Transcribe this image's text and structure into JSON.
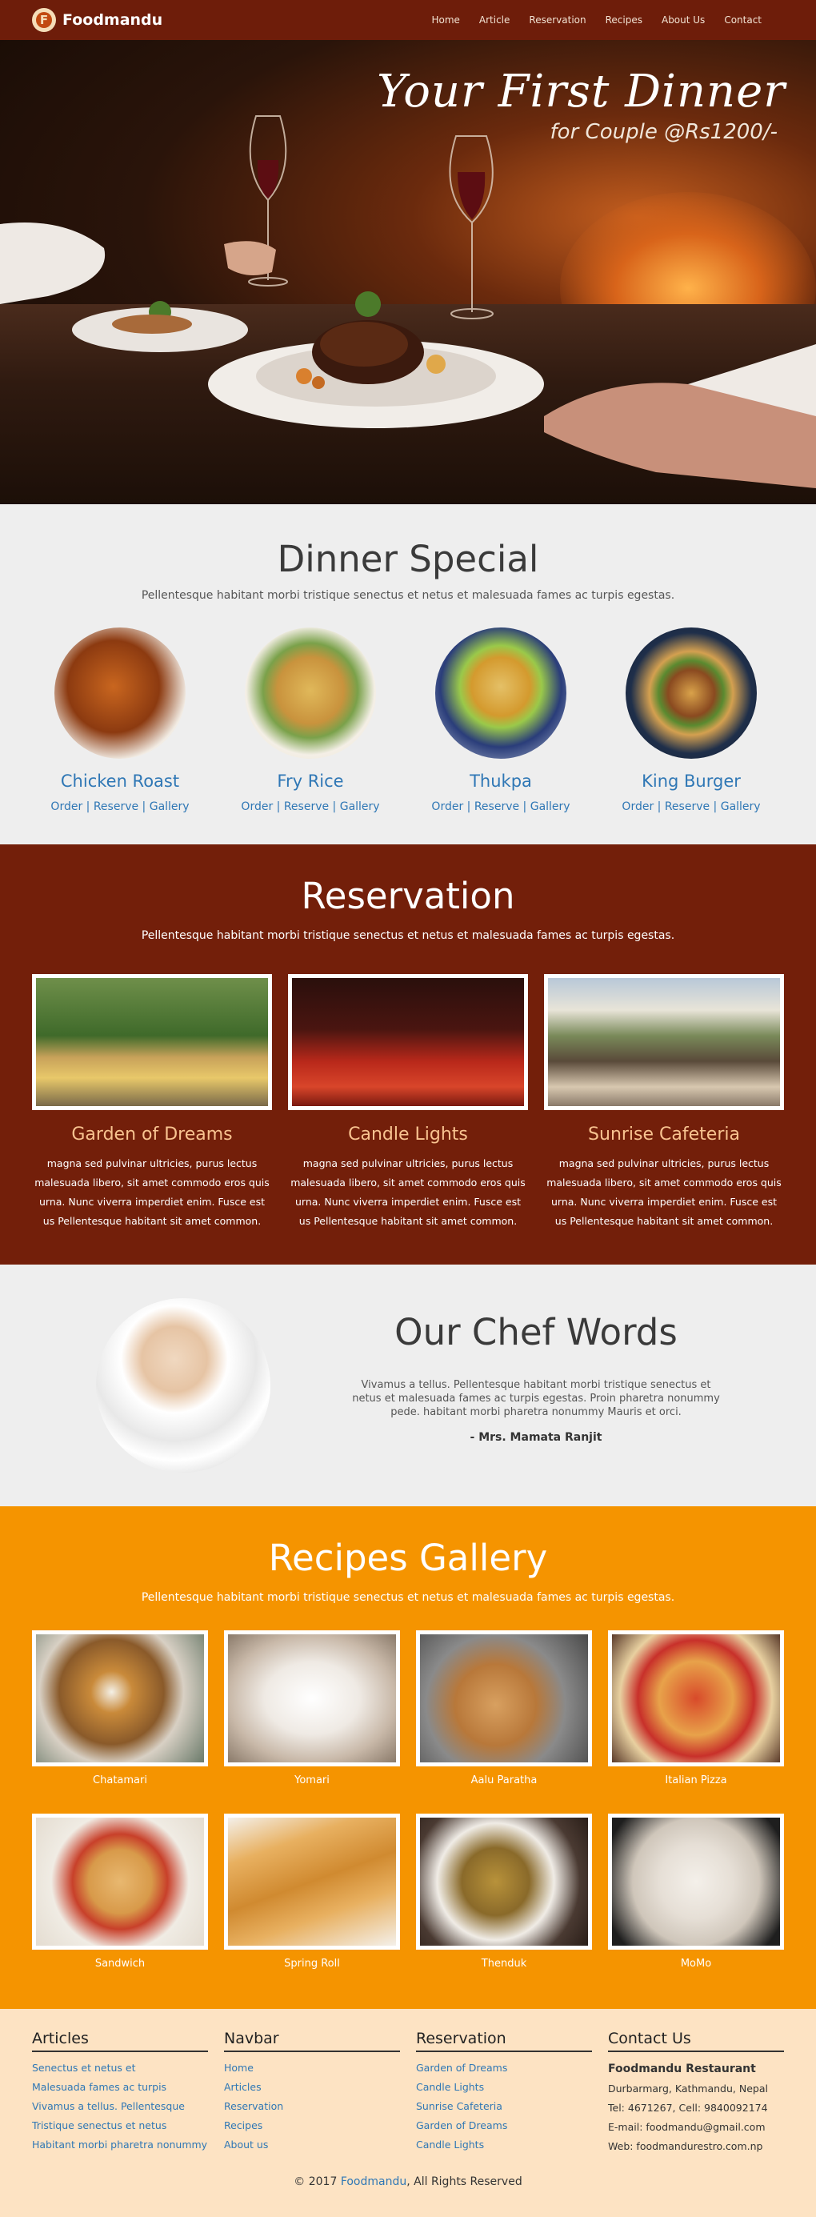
{
  "nav": {
    "brand": "Foodmandu",
    "links": [
      "Home",
      "Article",
      "Reservation",
      "Recipes",
      "About Us",
      "Contact"
    ]
  },
  "hero": {
    "title": "Your First Dinner",
    "subtitle": "for Couple @Rs1200/-"
  },
  "dinner": {
    "title": "Dinner Special",
    "description": "Pellentesque habitant morbi tristique senectus et netus et malesuada fames ac turpis egestas.",
    "dishes": [
      {
        "name": "Chicken Roast",
        "links": "Order | Reserve | Gallery"
      },
      {
        "name": "Fry Rice",
        "links": "Order | Reserve | Gallery"
      },
      {
        "name": "Thukpa",
        "links": "Order | Reserve | Gallery"
      },
      {
        "name": "King Burger",
        "links": "Order | Reserve | Gallery"
      }
    ]
  },
  "reservation": {
    "title": "Reservation",
    "description": "Pellentesque habitant morbi tristique senectus et netus et malesuada fames ac turpis egestas.",
    "venues": [
      {
        "name": "Garden of Dreams",
        "text": "magna sed pulvinar ultricies, purus lectus malesuada libero, sit amet commodo eros quis urna. Nunc viverra imperdiet enim. Fusce est us Pellentesque habitant sit amet common."
      },
      {
        "name": "Candle Lights",
        "text": "magna sed pulvinar ultricies, purus lectus malesuada libero, sit amet commodo eros quis urna. Nunc viverra imperdiet enim. Fusce est us Pellentesque habitant sit amet common."
      },
      {
        "name": "Sunrise Cafeteria",
        "text": "magna sed pulvinar ultricies, purus lectus malesuada libero, sit amet commodo eros quis urna. Nunc viverra imperdiet enim. Fusce est us Pellentesque habitant sit amet common."
      }
    ]
  },
  "chef": {
    "title": "Our Chef Words",
    "text": "Vivamus a tellus. Pellentesque habitant morbi tristique senectus et netus et malesuada fames ac turpis egestas. Proin pharetra nonummy pede. habitant morbi pharetra nonummy Mauris et orci.",
    "signature": "- Mrs. Mamata Ranjit"
  },
  "recipes": {
    "title": "Recipes Gallery",
    "description": "Pellentesque habitant morbi tristique senectus et netus et malesuada fames ac turpis egestas.",
    "items": [
      "Chatamari",
      "Yomari",
      "Aalu Paratha",
      "Italian Pizza",
      "Sandwich",
      "Spring Roll",
      "Thenduk",
      "MoMo"
    ]
  },
  "footer": {
    "articles": {
      "title": "Articles",
      "items": [
        "Senectus et netus et",
        "Malesuada fames ac turpis",
        "Vivamus a tellus. Pellentesque",
        "Tristique senectus et netus",
        "Habitant morbi pharetra nonummy"
      ]
    },
    "navbar": {
      "title": "Navbar",
      "items": [
        "Home",
        "Articles",
        "Reservation",
        "Recipes",
        "About us"
      ]
    },
    "reservation": {
      "title": "Reservation",
      "items": [
        "Garden of Dreams",
        "Candle Lights",
        "Sunrise Cafeteria",
        "Garden of Dreams",
        "Candle Lights"
      ]
    },
    "contact": {
      "title": "Contact Us",
      "name": "Foodmandu Restaurant",
      "address": "Durbarmarg, Kathmandu, Nepal",
      "phone": "Tel: 4671267, Cell: 9840092174",
      "email": "E-mail: foodmandu@gmail.com",
      "web": "Web: foodmandurestro.com.np"
    },
    "copyright_prefix": "© 2017 ",
    "copyright_link": "Foodmandu",
    "copyright_suffix": ", All Rights Reserved"
  },
  "colors": {
    "nav_bg": "#6e1d0a",
    "reservation_bg": "#731f0a",
    "recipes_bg": "#f59400",
    "footer_bg": "#fde3c3",
    "link_blue": "#2f77b5",
    "venue_title": "#f8c390"
  }
}
